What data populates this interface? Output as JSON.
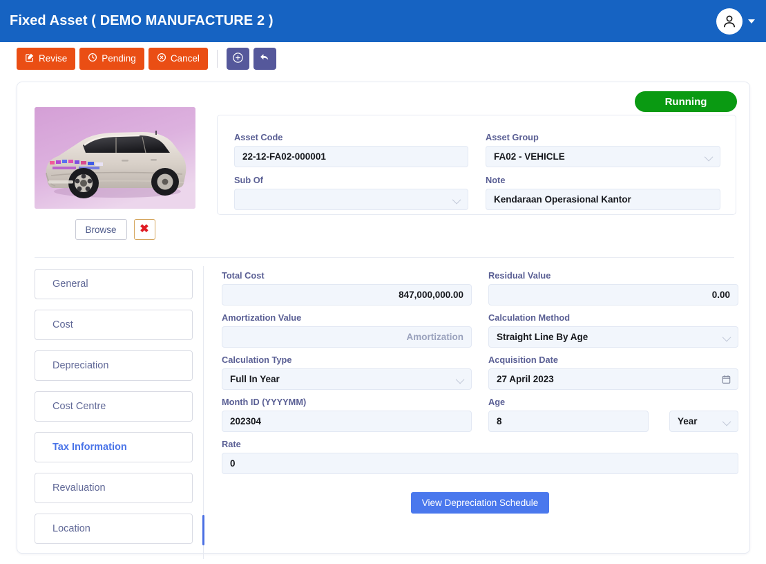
{
  "header": {
    "title": "Fixed Asset ( DEMO MANUFACTURE 2 )",
    "avatar_icon": "user-avatar-icon",
    "caret_icon": "chevron-down-icon"
  },
  "toolbar": {
    "buttons": [
      {
        "label": "Revise",
        "icon": "edit-square-icon",
        "color": "#ea4e14"
      },
      {
        "label": "Pending",
        "icon": "clock-icon",
        "color": "#ea4e14"
      },
      {
        "label": "Cancel",
        "icon": "cancel-circle-icon",
        "color": "#ea4e14"
      }
    ],
    "icon_buttons": [
      {
        "name": "add-button",
        "icon": "plus-circle-icon",
        "color": "#55589b"
      },
      {
        "name": "undo-button",
        "icon": "undo-arrow-icon",
        "color": "#55589b"
      }
    ]
  },
  "status": {
    "label": "Running",
    "color": "#0a9a12"
  },
  "photo": {
    "alt": "vehicle-photo",
    "browse_label": "Browse",
    "remove_label": "✖"
  },
  "asset_header": {
    "asset_code": {
      "label": "Asset Code",
      "value": "22-12-FA02-000001"
    },
    "asset_group": {
      "label": "Asset Group",
      "value": "FA02 - VEHICLE"
    },
    "sub_of": {
      "label": "Sub Of",
      "value": ""
    },
    "note": {
      "label": "Note",
      "value": "Kendaraan Operasional Kantor"
    }
  },
  "tabs": [
    {
      "label": "General",
      "active": false
    },
    {
      "label": "Cost",
      "active": false
    },
    {
      "label": "Depreciation",
      "active": false
    },
    {
      "label": "Cost Centre",
      "active": false
    },
    {
      "label": "Tax Information",
      "active": true
    },
    {
      "label": "Revaluation",
      "active": false
    },
    {
      "label": "Location",
      "active": false
    }
  ],
  "tax_form": {
    "total_cost": {
      "label": "Total Cost",
      "value": "847,000,000.00"
    },
    "residual_value": {
      "label": "Residual Value",
      "value": "0.00"
    },
    "amortization_value": {
      "label": "Amortization Value",
      "value": "",
      "placeholder": "Amortization"
    },
    "calculation_method": {
      "label": "Calculation Method",
      "value": "Straight Line By Age"
    },
    "calculation_type": {
      "label": "Calculation Type",
      "value": "Full In Year"
    },
    "acquisition_date": {
      "label": "Acquisition Date",
      "value": "27 April 2023",
      "icon": "calendar-icon"
    },
    "month_id": {
      "label": "Month ID (YYYYMM)",
      "value": "202304"
    },
    "age": {
      "label": "Age",
      "value": "8"
    },
    "age_unit": {
      "value": "Year"
    },
    "rate": {
      "label": "Rate",
      "value": "0"
    },
    "view_schedule_label": "View Depreciation Schedule"
  },
  "colors": {
    "header_blue": "#1663c2",
    "action_orange": "#ea4e14",
    "icon_purple": "#55589b",
    "status_green": "#0a9a12",
    "primary_blue": "#4a78ed",
    "active_tab_blue": "#4a74e8",
    "input_bg": "#f2f6fc",
    "label_text": "#5a5f94"
  }
}
